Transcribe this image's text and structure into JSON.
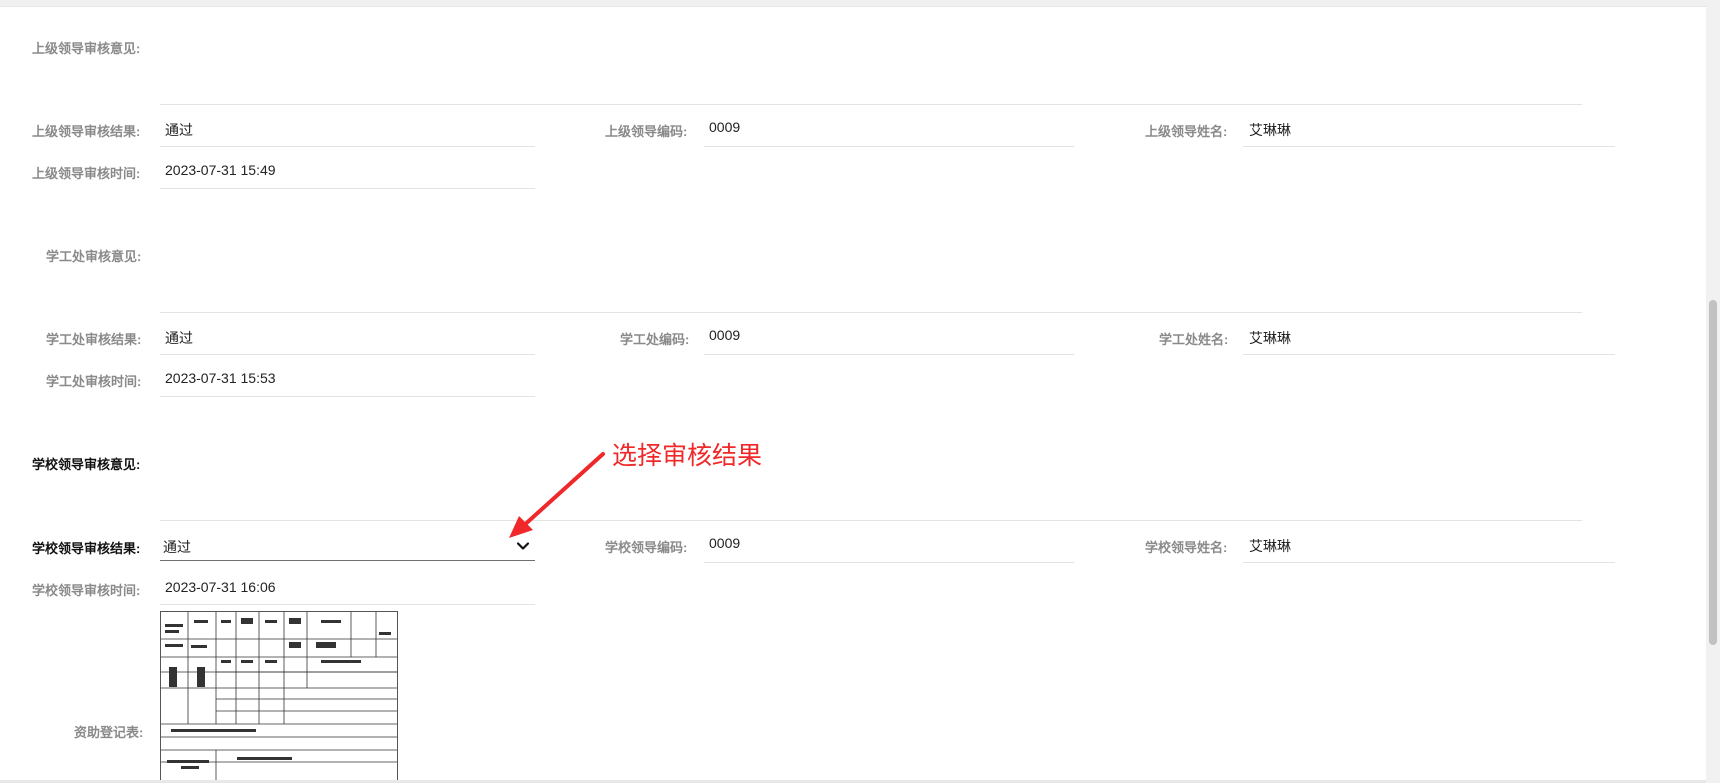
{
  "superior": {
    "opinion_label": "上级领导审核意见:",
    "result_label": "上级领导审核结果:",
    "result_value": "通过",
    "code_label": "上级领导编码:",
    "code_value": "0009",
    "name_label": "上级领导姓名:",
    "name_value": "艾琳琳",
    "time_label": "上级领导审核时间:",
    "time_value": "2023-07-31 15:49"
  },
  "student_affairs": {
    "opinion_label": "学工处审核意见:",
    "result_label": "学工处审核结果:",
    "result_value": "通过",
    "code_label": "学工处编码:",
    "code_value": "0009",
    "name_label": "学工处姓名:",
    "name_value": "艾琳琳",
    "time_label": "学工处审核时间:",
    "time_value": "2023-07-31 15:53"
  },
  "school": {
    "opinion_label": "学校领导审核意见:",
    "result_label": "学校领导审核结果:",
    "result_value": "通过",
    "code_label": "学校领导编码:",
    "code_value": "0009",
    "name_label": "学校领导姓名:",
    "name_value": "艾琳琳",
    "time_label": "学校领导审核时间:",
    "time_value": "2023-07-31 16:06"
  },
  "attachment": {
    "label": "资助登记表:"
  },
  "annotation": {
    "text": "选择审核结果",
    "color": "#f0282a"
  },
  "icons": {
    "select": "chevron-down-icon",
    "arrow": "red-arrow-icon"
  }
}
